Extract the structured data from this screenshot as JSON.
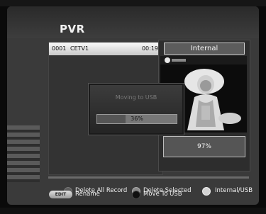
{
  "header": {
    "title": "PVR"
  },
  "recordings": [
    {
      "number": "0001",
      "channel": "CETV1",
      "duration": "00:19"
    }
  ],
  "storage": {
    "label": "Internal",
    "usage": "97%"
  },
  "dialog": {
    "title": "Moving to USB",
    "progress_text": "36%",
    "progress_value": 36
  },
  "legend": {
    "delete_all": "Delete All Record",
    "delete_selected": "Delete Selected",
    "internal_usb": "Internal/USB",
    "edit_key": "EDIT",
    "rename": "Rename",
    "move_to_usb": "Move To USB"
  },
  "colors": {
    "red_key": "#5c5c5c",
    "green_key": "#8a8a8a",
    "yellow_key": "#d4d4d4",
    "blue_key": "#101010"
  }
}
